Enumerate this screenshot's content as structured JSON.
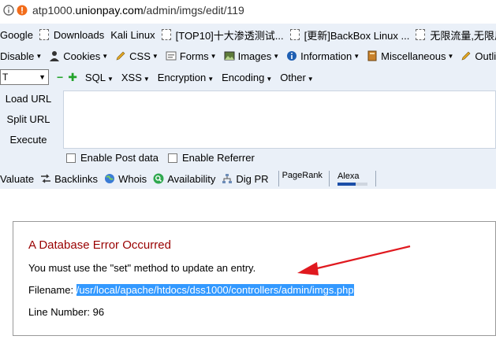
{
  "browser": {
    "url_prefix": "atp1000.",
    "url_host": "unionpay.com",
    "url_path": "/admin/imgs/edit/119"
  },
  "bookmarks": [
    {
      "label": "Google"
    },
    {
      "label": "Downloads"
    },
    {
      "label": "Kali Linux"
    },
    {
      "label": "[TOP10]十大渗透测试..."
    },
    {
      "label": "[更新]BackBox Linux ..."
    },
    {
      "label": "无限流量,无限用户"
    }
  ],
  "webdev_toolbar": [
    {
      "label": "Disable",
      "icon": "disable-icon"
    },
    {
      "label": "Cookies",
      "icon": "person-icon"
    },
    {
      "label": "CSS",
      "icon": "pencil-icon"
    },
    {
      "label": "Forms",
      "icon": "form-icon"
    },
    {
      "label": "Images",
      "icon": "image-icon"
    },
    {
      "label": "Information",
      "icon": "info-icon"
    },
    {
      "label": "Miscellaneous",
      "icon": "book-icon"
    },
    {
      "label": "Outline",
      "icon": "pencil-icon"
    }
  ],
  "hackbar": {
    "select_value": "T",
    "menus": [
      "SQL",
      "XSS",
      "Encryption",
      "Encoding",
      "Other"
    ],
    "load_url": "Load URL",
    "split_url": "Split URL",
    "execute": "Execute",
    "enable_post": "Enable Post data",
    "enable_referrer": "Enable Referrer"
  },
  "seo_toolbar": [
    {
      "label": "Valuate",
      "icon": ""
    },
    {
      "label": "Backlinks",
      "icon": "arrows-icon"
    },
    {
      "label": "Whois",
      "icon": "globe-icon"
    },
    {
      "label": "Availability",
      "icon": "search-icon"
    },
    {
      "label": "Dig PR",
      "icon": "network-icon"
    }
  ],
  "pagerank_label": "PageRank",
  "alexa_label": "Alexa",
  "alexa_level": 0.6,
  "error": {
    "title": "A Database Error Occurred",
    "message": "You must use the \"set\" method to update an entry.",
    "filename_label": "Filename:",
    "filename_value": "/usr/local/apache/htdocs/dss1000/controllers/admin/imgs.php",
    "line_label": "Line Number: 96"
  },
  "colors": {
    "error_title": "#990000",
    "highlight": "#3399ff",
    "arrow": "#e0191f",
    "toolbar_bg": "#eaf0f8"
  }
}
